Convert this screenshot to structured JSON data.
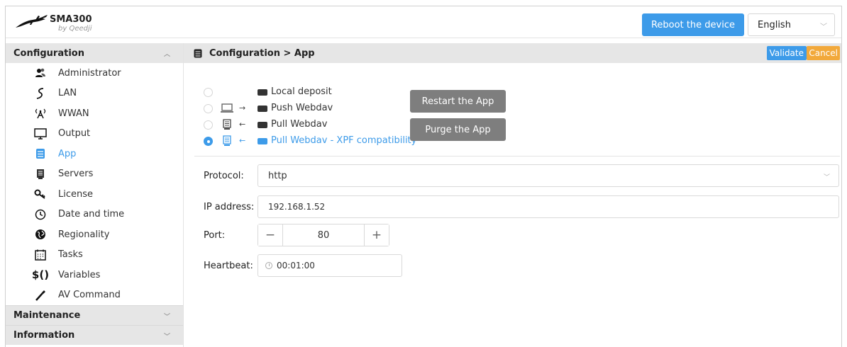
{
  "header": {
    "brand": "SMA300",
    "brand_by": "by Qeedji",
    "reboot_label": "Reboot the device",
    "language": "English"
  },
  "sidebar": {
    "section_configuration": "Configuration",
    "items": [
      {
        "label": "Administrator",
        "icon": "users-icon"
      },
      {
        "label": "LAN",
        "icon": "lan-icon"
      },
      {
        "label": "WWAN",
        "icon": "antenna-icon"
      },
      {
        "label": "Output",
        "icon": "monitor-icon"
      },
      {
        "label": "App",
        "icon": "database-icon"
      },
      {
        "label": "Servers",
        "icon": "server-icon"
      },
      {
        "label": "License",
        "icon": "key-icon"
      },
      {
        "label": "Date and time",
        "icon": "clock-icon"
      },
      {
        "label": "Regionality",
        "icon": "globe-icon"
      },
      {
        "label": "Tasks",
        "icon": "calendar-icon"
      },
      {
        "label": "Variables",
        "icon": "variables-icon"
      },
      {
        "label": "AV Command",
        "icon": "remote-icon"
      }
    ],
    "section_maintenance": "Maintenance",
    "section_information": "Information",
    "active_item": "App"
  },
  "main": {
    "breadcrumb": "Configuration > App",
    "validate_label": "Validate",
    "cancel_label": "Cancel",
    "modes": [
      {
        "label": "Local deposit",
        "selected": false
      },
      {
        "label": "Push Webdav",
        "selected": false
      },
      {
        "label": "Pull Webdav",
        "selected": false
      },
      {
        "label": "Pull Webdav - XPF compatibility",
        "selected": true
      }
    ],
    "restart_label": "Restart the App",
    "purge_label": "Purge the App",
    "protocol_label": "Protocol:",
    "protocol_value": "http",
    "ip_label": "IP address:",
    "ip_value": "192.168.1.52",
    "port_label": "Port:",
    "port_value": "80",
    "heartbeat_label": "Heartbeat:",
    "heartbeat_value": "00:01:00"
  },
  "colors": {
    "accent": "#3d9be9",
    "cancel": "#f2a93b",
    "gray_button": "#7e7e7e",
    "section_bg": "#e6e6e6"
  }
}
